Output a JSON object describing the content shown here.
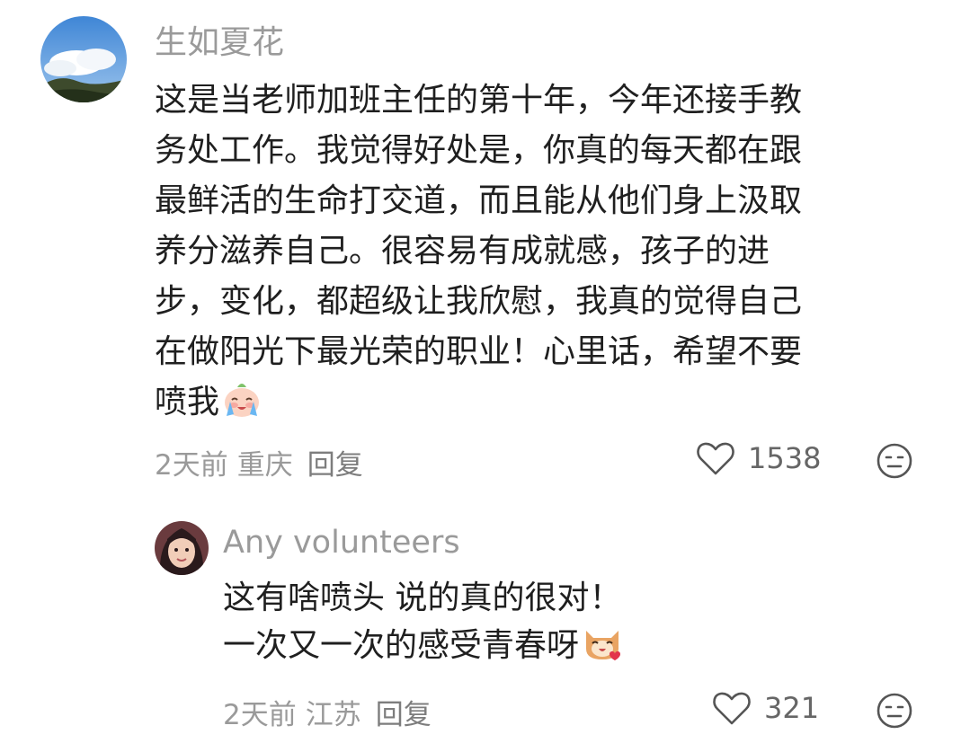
{
  "comments": [
    {
      "username": "生如夏花",
      "avatar_icon": "sky-clouds-avatar",
      "lines": [
        "这是当老师加班主任的第十年，今年还接手教",
        "务处工作。我觉得好处是，你真的每天都在跟",
        "最鲜活的生命打交道，而且能从他们身上汲取",
        "养分滋养自己。很容易有成就感，孩子的进",
        "步，变化，都超级让我欣慰，我真的觉得自己",
        "在做阳光下最光荣的职业！心里话，希望不要",
        "喷我"
      ],
      "emoji": "crying-face-emoji",
      "time": "2天前",
      "location": "重庆",
      "reply": "回复",
      "likes": "1538"
    },
    {
      "username": "Any volunteers",
      "avatar_icon": "girl-portrait-avatar",
      "lines": [
        "这有啥喷头 说的真的很对！",
        "一次又一次的感受青春呀"
      ],
      "emoji": "cat-heart-emoji",
      "time": "2天前",
      "location": "江苏",
      "reply": "回复",
      "likes": "321"
    }
  ]
}
